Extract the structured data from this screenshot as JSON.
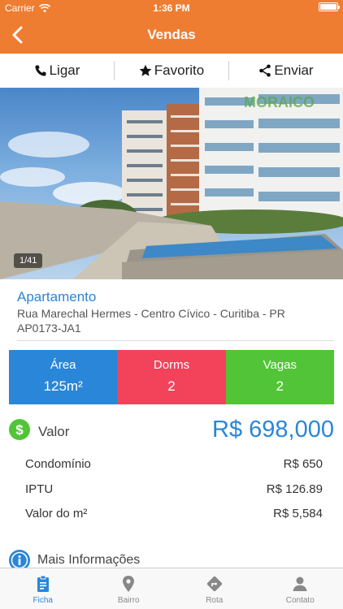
{
  "status_bar": {
    "carrier": "Carrier",
    "time": "1:36 PM"
  },
  "nav": {
    "title": "Vendas"
  },
  "actions": {
    "call": "Ligar",
    "favorite": "Favorito",
    "share": "Enviar"
  },
  "photo": {
    "counter": "1/41",
    "watermark": "MORAICO"
  },
  "property": {
    "type": "Apartamento",
    "address": "Rua Marechal Hermes - Centro Cívico - Curitiba - PR",
    "code": "AP0173-JA1"
  },
  "stats": [
    {
      "label": "Área",
      "value": "125m²",
      "color": "#2a86d8"
    },
    {
      "label": "Dorms",
      "value": "2",
      "color": "#f2435a"
    },
    {
      "label": "Vagas",
      "value": "2",
      "color": "#52c437"
    }
  ],
  "price": {
    "label": "Valor",
    "value": "R$ 698,000"
  },
  "fees": [
    {
      "label": "Condomínio",
      "value": "R$ 650"
    },
    {
      "label": "IPTU",
      "value": "R$ 126.89"
    },
    {
      "label": "Valor do m²",
      "value": "R$ 5,584"
    }
  ],
  "more_info": {
    "label": "Mais Informações"
  },
  "tabs": [
    {
      "label": "Ficha",
      "icon": "document-icon",
      "active": true
    },
    {
      "label": "Bairro",
      "icon": "map-pin-icon",
      "active": false
    },
    {
      "label": "Rota",
      "icon": "route-icon",
      "active": false
    },
    {
      "label": "Contato",
      "icon": "person-icon",
      "active": false
    }
  ],
  "colors": {
    "brand": "#ef7d31",
    "accent": "#2a86d8",
    "green": "#52c437",
    "red": "#f2435a"
  }
}
